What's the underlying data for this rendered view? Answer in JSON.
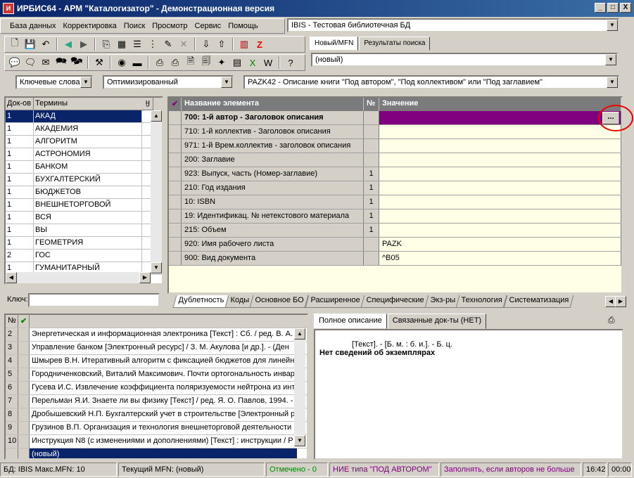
{
  "window": {
    "title": "ИРБИС64 - АРМ \"Каталогизатор\" - Демонстрационная версия",
    "icon": "irbis-app-icon",
    "controls": [
      "_",
      "□",
      "X"
    ]
  },
  "menu": [
    "База данных",
    "Корректировка",
    "Поиск",
    "Просмотр",
    "Сервис",
    "Помощь"
  ],
  "database_select": "IBIS - Тестовая библиотечная БД",
  "top_tabs": [
    "Новый/MFN",
    "Результаты поиска"
  ],
  "record_select": "(новый)",
  "search_mode": "Ключевые слова",
  "optimization": "Оптимизированный",
  "worksheet": "PAZK42 - Описание книги \"Под автором\", \"Под коллективом\" или \"Под заглавием\"",
  "terms": {
    "headers": [
      "Док-ов",
      "Термины"
    ],
    "pin": "ӈ",
    "rows": [
      {
        "count": "1",
        "term": "АКАД"
      },
      {
        "count": "1",
        "term": "АКАДЕМИЯ"
      },
      {
        "count": "1",
        "term": "АЛГОРИТМ"
      },
      {
        "count": "1",
        "term": "АСТРОНОМИЯ"
      },
      {
        "count": "1",
        "term": "БАНКОМ"
      },
      {
        "count": "1",
        "term": "БУХГАЛТЕРСКИЙ"
      },
      {
        "count": "1",
        "term": "БЮДЖЕТОВ"
      },
      {
        "count": "1",
        "term": "ВНЕШНЕТОРГОВОЙ"
      },
      {
        "count": "1",
        "term": "ВСЯ"
      },
      {
        "count": "1",
        "term": "ВЫ"
      },
      {
        "count": "1",
        "term": "ГЕОМЕТРИЯ"
      },
      {
        "count": "2",
        "term": "ГОС"
      },
      {
        "count": "1",
        "term": "ГУМАНИТАРНЫЙ"
      }
    ],
    "key_label": "Ключ:"
  },
  "editor": {
    "headers": {
      "check": "✔",
      "name": "Название элемента",
      "num": "№",
      "value": "Значение"
    },
    "rows": [
      {
        "name": "700: 1-й  автор - Заголовок описания",
        "num": "",
        "value": ""
      },
      {
        "name": "710: 1-й коллектив - Заголовок описания",
        "num": "",
        "value": ""
      },
      {
        "name": "971: 1-й Врем.коллектив - заголовок описания",
        "num": "",
        "value": ""
      },
      {
        "name": "200: Заглавие",
        "num": "",
        "value": ""
      },
      {
        "name": "923: Выпуск, часть (Номер-заглавие)",
        "num": "1",
        "value": ""
      },
      {
        "name": "210: Год издания",
        "num": "1",
        "value": ""
      },
      {
        "name": "10: ISBN",
        "num": "1",
        "value": ""
      },
      {
        "name": "19: Идентификац. № нетекстового материала",
        "num": "1",
        "value": ""
      },
      {
        "name": "215: Объем",
        "num": "1",
        "value": ""
      },
      {
        "name": "920: Имя рабочего листа",
        "num": "",
        "value": "PAZK"
      },
      {
        "name": "900: Вид документа",
        "num": "",
        "value": "^B05"
      }
    ],
    "ellipsis": "...",
    "active_color": "#800080"
  },
  "bottom_tabs": [
    "Дублетность",
    "Коды",
    "Основное БО",
    "Расширенное",
    "Специфические",
    "Экз-ры",
    "Технология",
    "Систематизация"
  ],
  "list": {
    "headers": [
      "№",
      "✔"
    ],
    "rows": [
      {
        "n": "2",
        "text": "Энергетическая и информационная электроника [Текст] : Сб. / ред. В. А. Л"
      },
      {
        "n": "3",
        "text": "Управление банком [Электронный ресурс]  / З. М. Акулова [и др.]. - (Ден"
      },
      {
        "n": "4",
        "text": "Шмырев В.Н. Итеративный алгоритм с фиксацией бюджетов для линейно"
      },
      {
        "n": "5",
        "text": "Городниченковский, Виталий Максимович. Почти ортогональность инвар"
      },
      {
        "n": "6",
        "text": "Гусева И.С. Извлечение коэффициента поляризуемости нейтрона из инт"
      },
      {
        "n": "7",
        "text": "Перельман Я.И. Знаете ли вы физику [Текст] / ред. Я. О. Павлов, 1994. -"
      },
      {
        "n": "8",
        "text": "Дробышевский Н.П. Бухгалтерский учет в строительстве [Электронный р"
      },
      {
        "n": "9",
        "text": "Грузинов В.П. Организация и технология внешнеторговой деятельности ["
      },
      {
        "n": "10",
        "text": "Инструкция N8   (с изменениями и дополнениями) [Текст] : инструкции / Р"
      },
      {
        "n": "",
        "text": "(новый)"
      }
    ]
  },
  "desc_tabs": [
    "Полное описание",
    "Связанные док-ты (НЕТ)"
  ],
  "description": {
    "line1": "[Текст]. - [Б. м. : б. и.]. - Б. ц.",
    "line2": "Нет сведений об экземплярах"
  },
  "status": {
    "db": "БД: IBIS Макс.MFN: 10",
    "current": "Текущий MFN: (новый)",
    "marked": "Отмечено - 0",
    "hint1": "НИЕ типа \"ПОД АВТОРОМ\"",
    "hint2": "Заполнять, если авторов не больше",
    "time": "16:42",
    "time2": "00:00"
  }
}
